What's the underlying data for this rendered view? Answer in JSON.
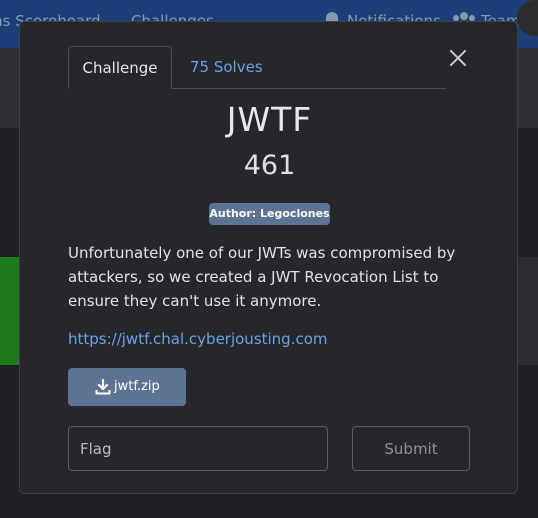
{
  "background_nav": {
    "items": [
      "ms",
      "Scoreboard",
      "Challenges",
      "Notifications",
      "Team"
    ]
  },
  "modal": {
    "tabs": [
      {
        "label": "Challenge",
        "active": true
      },
      {
        "label": "75 Solves",
        "active": false
      }
    ],
    "close_icon": "close-icon",
    "challenge": {
      "name": "JWTF",
      "points": "461",
      "author": "Author: Legoclones",
      "description": "Unfortunately one of our JWTs was compromised by attackers, so we created a JWT Revocation List to ensure they can't use it anymore.",
      "link": "https://jwtf.chal.cyberjousting.com",
      "file": {
        "label": "jwtf.zip",
        "icon": "download-icon"
      }
    },
    "flag": {
      "placeholder": "Flag",
      "value": ""
    },
    "submit_label": "Submit"
  },
  "colors": {
    "accent": "#6aa3e8",
    "badge": "#5d7394",
    "nav": "#1d3f79"
  }
}
